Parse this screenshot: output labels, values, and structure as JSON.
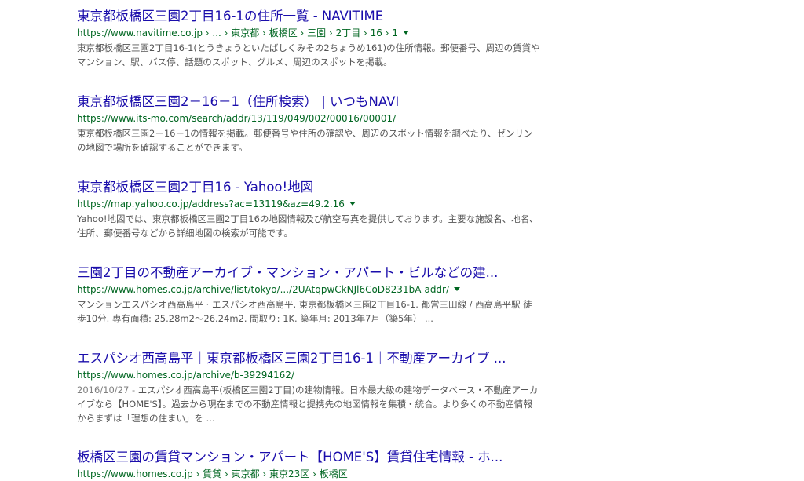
{
  "results": [
    {
      "title": "東京都板橋区三園2丁目16-1の住所一覧 - NAVITIME",
      "url": "https://www.navitime.co.jp › ... › 東京都 › 板橋区 › 三園 › 2丁目 › 16 › 1",
      "snippet": "東京都板橋区三園2丁目16-1(とうきょうといたばしくみその2ちょうめ161)の住所情報。郵便番号、周辺の賃貸やマンション、駅、バス停、話題のスポット、グルメ、周辺のスポットを掲載。"
    },
    {
      "title": "東京都板橋区三園2－16－1（住所検索） | いつもNAVI",
      "url": "https://www.its-mo.com/search/addr/13/119/049/002/00016/00001/",
      "snippet": "東京都板橋区三園2－16－1の情報を掲載。郵便番号や住所の確認や、周辺のスポット情報を調べたり、ゼンリンの地図で場所を確認することができます。"
    },
    {
      "title": "東京都板橋区三園2丁目16 - Yahoo!地図",
      "url": "https://map.yahoo.co.jp/address?ac=13119&az=49.2.16",
      "snippet": "Yahoo!地図では、東京都板橋区三園2丁目16の地図情報及び航空写真を提供しております。主要な施設名、地名、住所、郵便番号などから詳細地図の検索が可能です。"
    },
    {
      "title": "三園2丁目の不動産アーカイブ・マンション・アパート・ビルなどの建...",
      "url": "https://www.homes.co.jp/archive/list/tokyo/.../2UAtqpwCkNJl6CoD8231bA-addr/",
      "snippet": "マンションエスパシオ西高島平 · エスパシオ西高島平. 東京都板橋区三園2丁目16-1. 都営三田線 / 西高島平駅 徒歩10分. 専有面積: 25.28m2～26.24m2. 間取り: 1K. 築年月: 2013年7月（築5年） ..."
    },
    {
      "title": "エスパシオ西高島平｜東京都板橋区三園2丁目16-1｜不動産アーカイブ ...",
      "url": "https://www.homes.co.jp/archive/b-39294162/",
      "date": "2016/10/27 - ",
      "snippet": "エスパシオ西高島平(板橋区三園2丁目)の建物情報。日本最大級の建物データベース・不動産アーカイブなら【HOME'S】。過去から現在までの不動産情報と提携先の地図情報を集積・統合。より多くの不動産情報からまずは「理想の住まい」を ..."
    },
    {
      "title": "板橋区三園の賃貸マンション・アパート【HOME'S】賃貸住宅情報 - ホ...",
      "url": "https://www.homes.co.jp › 賃貸 › 東京都 › 東京23区 › 板橋区"
    }
  ]
}
